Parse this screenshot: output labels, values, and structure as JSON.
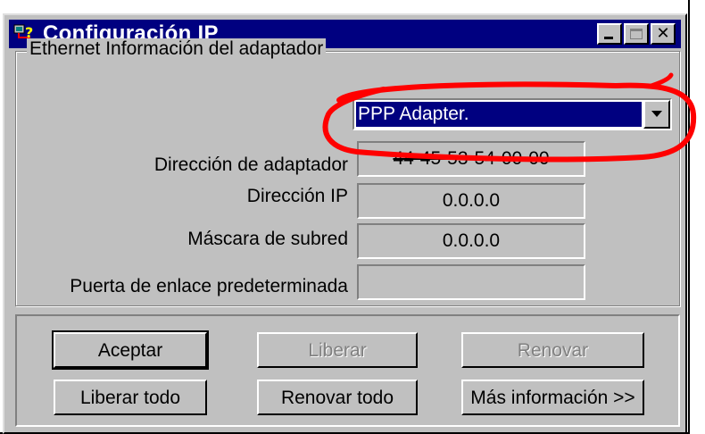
{
  "window": {
    "title": "Configuración IP"
  },
  "group": {
    "legend": "Ethernet  Información del adaptador"
  },
  "adapter_select": {
    "selected": "PPP Adapter."
  },
  "fields": [
    {
      "label": "Dirección de adaptador",
      "value": "44-45-53-54-00-00"
    },
    {
      "label": "Dirección IP",
      "value": "0.0.0.0"
    },
    {
      "label": "Máscara de subred",
      "value": "0.0.0.0"
    },
    {
      "label": "Puerta de enlace predeterminada",
      "value": ""
    }
  ],
  "buttons": {
    "aceptar": "Aceptar",
    "liberar": "Liberar",
    "renovar": "Renovar",
    "liberar_todo": "Liberar todo",
    "renovar_todo": "Renovar todo",
    "mas_info": "Más información >>"
  },
  "colors": {
    "titlebar": "#000080",
    "face": "#c0c0c0",
    "highlight_circle": "#ff0000"
  }
}
